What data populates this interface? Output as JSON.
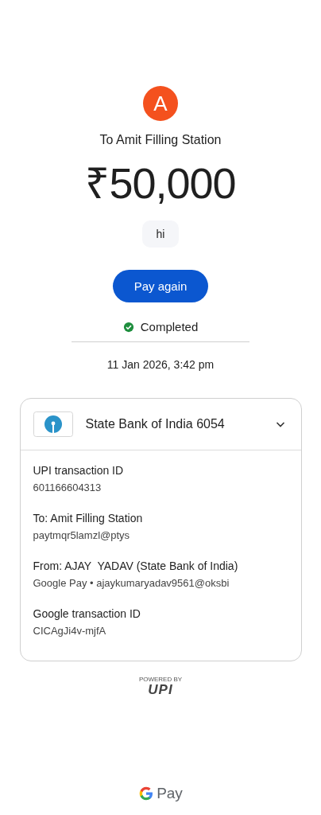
{
  "avatar": {
    "initial": "A",
    "color": "#f4511e"
  },
  "recipient": "To Amit Filling Station",
  "amount": "₹50,000",
  "note": "hi",
  "pay_again_button": "Pay again",
  "status": {
    "label": "Completed",
    "completed": true
  },
  "datetime": "11 Jan 2026, 3:42 pm",
  "details_card": {
    "account": "State Bank of India 6054",
    "expanded": true,
    "rows": [
      {
        "label": "UPI transaction ID",
        "value": "601166604313"
      },
      {
        "label": "To: Amit Filling Station",
        "value": "paytmqr5lamzl@ptys"
      },
      {
        "label": "From: AJAY  YADAV (State Bank of India)",
        "value": "Google Pay • ajaykumaryadav9561@oksbi"
      },
      {
        "label": "Google transaction ID",
        "value": "CICAgJi4v-mjfA"
      }
    ]
  },
  "upi_badge": {
    "caption": "POWERED BY",
    "logo": "UPI"
  },
  "footer_brand": "Pay"
}
